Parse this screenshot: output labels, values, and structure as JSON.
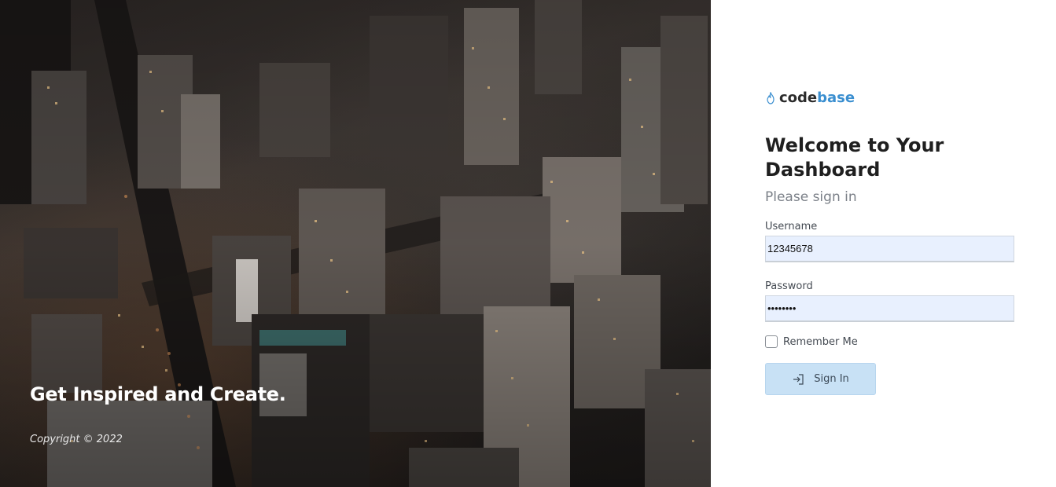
{
  "hero": {
    "title": "Get Inspired and Create.",
    "copyright": "Copyright © 2022",
    "image": "city-aerial-night-image"
  },
  "brand": {
    "icon": "flame-icon",
    "name_part1": "code",
    "name_part2": "base",
    "color_part2": "#3b8fd0"
  },
  "login": {
    "heading": "Welcome to Your Dashboard",
    "subheading": "Please sign in",
    "username": {
      "label": "Username",
      "value": "12345678"
    },
    "password": {
      "label": "Password",
      "value": "••••••••"
    },
    "remember": {
      "label": "Remember Me",
      "checked": false
    },
    "submit": {
      "label": "Sign In",
      "icon": "sign-in-icon"
    }
  },
  "colors": {
    "accent": "#3b8fd0",
    "input_autofill": "#e8f0fe",
    "button_bg": "#c8e1f5"
  }
}
